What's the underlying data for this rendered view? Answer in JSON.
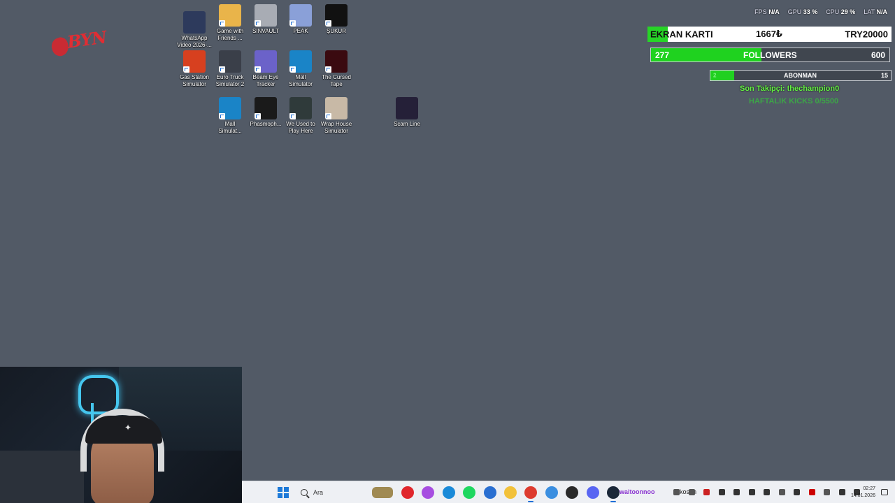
{
  "logo": {
    "text": "BYN"
  },
  "desktop_icons": [
    {
      "label": "WhatsApp\nVideo 2026-...",
      "icon": "video-file-icon",
      "color": "#2d3a5c"
    },
    {
      "label": "Game with\nFriends ...",
      "icon": "game-with-friends-icon",
      "color": "#e9b44a"
    },
    {
      "label": "SINVAULT",
      "icon": "sinvault-icon",
      "color": "#a8acb4"
    },
    {
      "label": "PEAK",
      "icon": "peak-icon",
      "color": "#8aa0d8"
    },
    {
      "label": "ŞUKUR",
      "icon": "sukur-icon",
      "color": "#111111"
    },
    {
      "label": "Gas Station\nSimulator",
      "icon": "gas-station-icon",
      "color": "#d7401f"
    },
    {
      "label": "Euro Truck\nSimulator 2",
      "icon": "euro-truck-icon",
      "color": "#3a3f49"
    },
    {
      "label": "Beam Eye\nTracker",
      "icon": "beam-eye-icon",
      "color": "#6b62c9"
    },
    {
      "label": "Mall\nSimulator",
      "icon": "mall-simulator-icon",
      "color": "#1a84c7"
    },
    {
      "label": "The Cursed\nTape",
      "icon": "cursed-tape-icon",
      "color": "#3a0a10"
    },
    {
      "label": "Mall\nSimulat...",
      "icon": "mall-simulator-icon",
      "color": "#1a84c7"
    },
    {
      "label": "Phasmoph...",
      "icon": "phasmophobia-icon",
      "color": "#1a1a1a"
    },
    {
      "label": "We Used to\nPlay Here",
      "icon": "we-used-to-play-icon",
      "color": "#2f3a3a"
    },
    {
      "label": "Wrap House\nSimulator",
      "icon": "wrap-house-icon",
      "color": "#c8b9a6"
    },
    {
      "label": "Scam Line",
      "icon": "scam-line-icon",
      "color": "#252038"
    }
  ],
  "perf": {
    "fps_label": "FPS",
    "fps_value": "N/A",
    "gpu_label": "GPU",
    "gpu_value": "33 %",
    "cpu_label": "CPU",
    "cpu_value": "29 %",
    "lat_label": "LAT",
    "lat_value": "N/A"
  },
  "gpu_goal": {
    "title": "EKRAN KARTI",
    "current": "1667₺",
    "target": "TRY20000",
    "progress": 0.083
  },
  "followers_goal": {
    "current": "277",
    "label": "FOLLOWERS",
    "target": "600",
    "progress": 0.462
  },
  "subs_goal": {
    "current": "2",
    "label": "ABONMAN",
    "target": "15",
    "progress": 0.133
  },
  "last_follower": "Son Takipçi: thechampion0",
  "weekly_kicks": "HAFTALIK KICKS 0/5500",
  "taskbar": {
    "search_placeholder": "Ara",
    "tray_user": "waitoonnoo",
    "tray_text": "kosun",
    "time": "02:27",
    "date": "14.01.2026",
    "apps": [
      {
        "name": "media-app-icon",
        "color": "#e0262c"
      },
      {
        "name": "copilot-icon",
        "color": "#a64de0"
      },
      {
        "name": "edge-icon",
        "color": "#1a8ad8"
      },
      {
        "name": "spotify-icon",
        "color": "#1ed760"
      },
      {
        "name": "store-icon",
        "color": "#2a6fd1"
      },
      {
        "name": "file-explorer-icon",
        "color": "#f2c13a"
      },
      {
        "name": "chrome-icon",
        "color": "#dd3b2f"
      },
      {
        "name": "network-app-icon",
        "color": "#3a8ee0"
      },
      {
        "name": "obs-icon",
        "color": "#2a2a2a"
      },
      {
        "name": "discord-icon",
        "color": "#5865f2"
      },
      {
        "name": "steam-icon",
        "color": "#1b2838"
      }
    ]
  }
}
